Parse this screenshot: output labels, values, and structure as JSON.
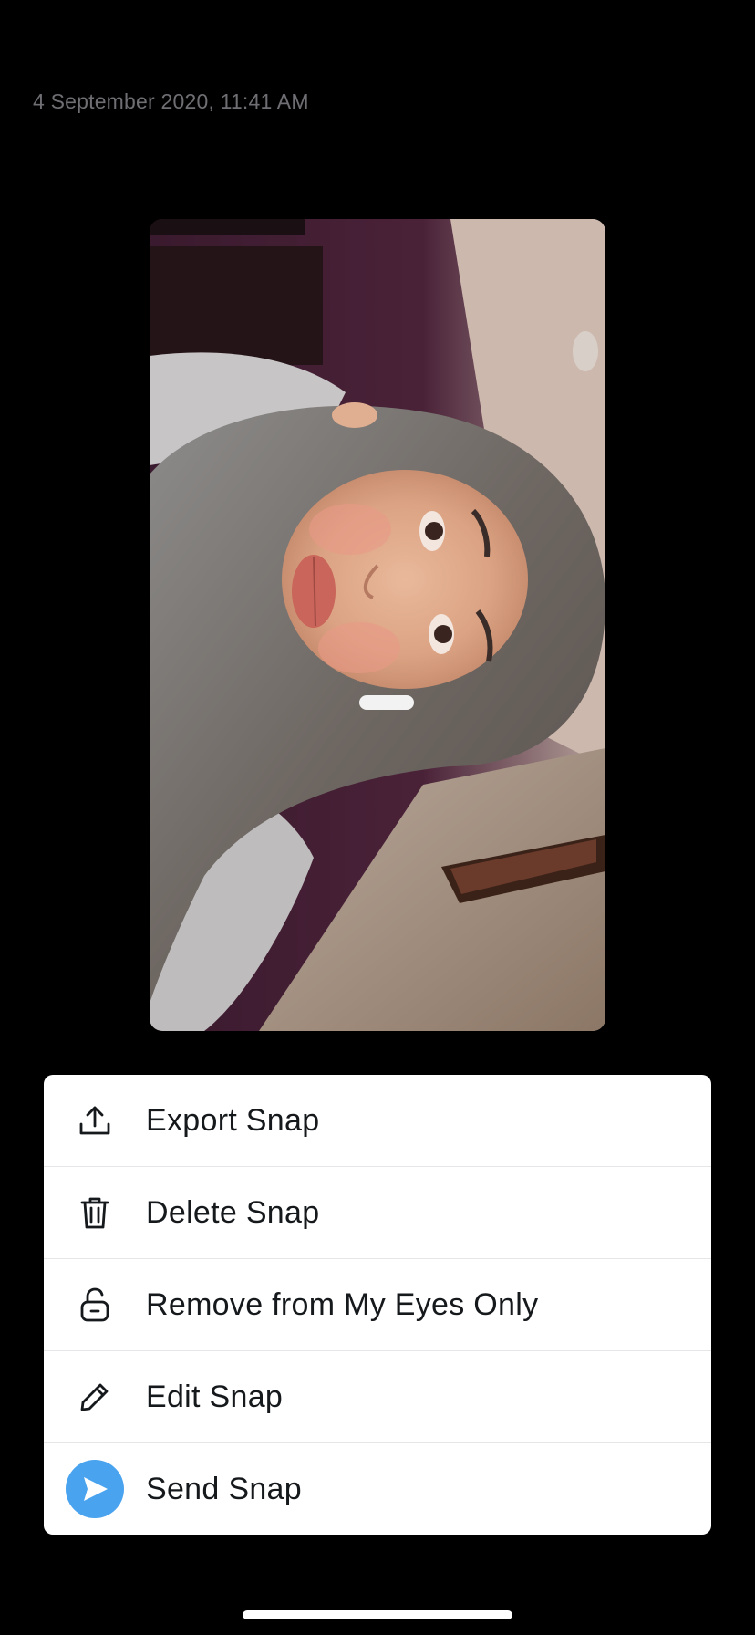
{
  "header": {
    "timestamp": "4 September 2020, 11:41 AM"
  },
  "snap": {
    "image_description_icon": "photo-snap"
  },
  "actions": [
    {
      "id": "export",
      "label": "Export Snap",
      "icon": "upload-icon"
    },
    {
      "id": "delete",
      "label": "Delete Snap",
      "icon": "trash-icon"
    },
    {
      "id": "remove",
      "label": "Remove from My Eyes Only",
      "icon": "unlock-icon"
    },
    {
      "id": "edit",
      "label": "Edit Snap",
      "icon": "pencil-icon"
    },
    {
      "id": "send",
      "label": "Send Snap",
      "icon": "send-icon"
    }
  ],
  "colors": {
    "background": "#000000",
    "sheet": "#ffffff",
    "send_accent": "#4aa3ee",
    "timestamp": "#6e6e73",
    "label": "#16191c"
  }
}
